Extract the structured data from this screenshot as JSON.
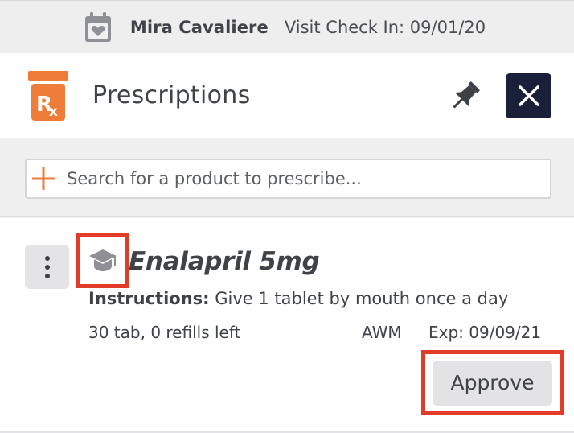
{
  "patient": {
    "name": "Mira Cavaliere",
    "visit_label": "Visit Check In: 09/01/20"
  },
  "panel": {
    "title": "Prescriptions",
    "icons": {
      "rx": "rx-bottle-icon",
      "pin": "pin-icon",
      "close": "close-icon"
    }
  },
  "search": {
    "placeholder": "Search for a product to prescribe...",
    "value": ""
  },
  "prescription": {
    "drug_name": "Enalapril 5mg",
    "instructions_label": "Instructions:",
    "instructions_text": " Give 1 tablet by mouth once a day",
    "quantity": "30 tab, 0 refills left",
    "prescriber": "AWM",
    "expiry": "Exp: 09/09/21",
    "approve_label": "Approve"
  },
  "colors": {
    "accent_orange": "#f07c3a",
    "highlight_red": "#e23b28",
    "close_bg": "#1a1f3a",
    "icon_gray": "#8e9095"
  }
}
